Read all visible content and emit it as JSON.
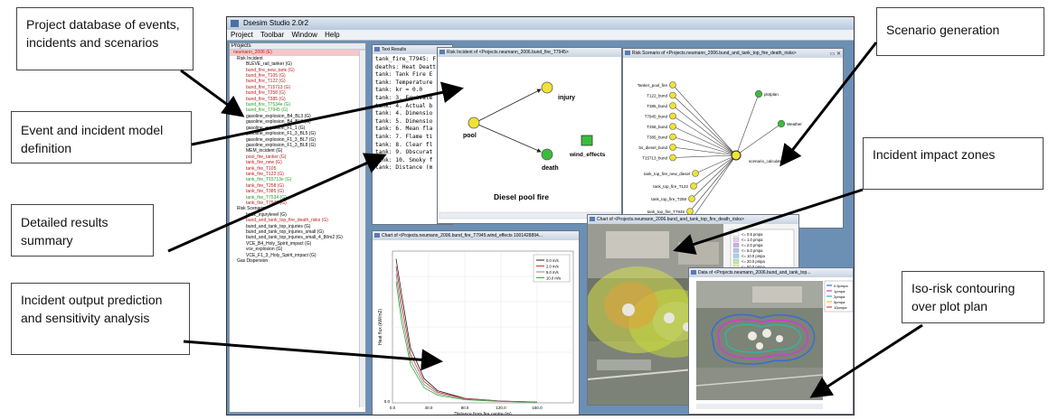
{
  "callouts": {
    "project_database": "Project database of events, incidents and scenarios",
    "event_incident": "Event and incident model definition",
    "detailed_results": "Detailed results summary",
    "incident_output": "Incident output prediction and sensitivity analysis",
    "scenario_generation": "Scenario generation",
    "impact_zones": "Incident impact zones",
    "iso_risk": "Iso-risk contouring over plot plan"
  },
  "app": {
    "title": "Dsesim Studio 2.0r2",
    "menu": [
      "Project",
      "Toolbar",
      "Window",
      "Help"
    ]
  },
  "tree": {
    "header": "Projects",
    "root": "neumann_2006 (E)",
    "risk_incident": "Risk Incident",
    "incidents": [
      {
        "label": "BLEVE_rail_tanker (G)",
        "color": "black"
      },
      {
        "label": "bund_fire_new_tank (G)",
        "color": "red"
      },
      {
        "label": "bund_fire_T105 (G)",
        "color": "red"
      },
      {
        "label": "bund_fire_T122 (G)",
        "color": "red"
      },
      {
        "label": "bund_fire_T15713 (G)",
        "color": "red"
      },
      {
        "label": "bund_fire_T258 (G)",
        "color": "red"
      },
      {
        "label": "bund_fire_T385 (G)",
        "color": "red"
      },
      {
        "label": "bund_fire_T7534e (G)",
        "color": "green"
      },
      {
        "label": "bund_fire_T7945 (G)",
        "color": "green"
      },
      {
        "label": "gasoline_explosion_B4_BL3 (G)",
        "color": "black"
      },
      {
        "label": "gasoline_explosion_B4_BL8 (G)",
        "color": "black"
      },
      {
        "label": "gasoline_explosion_F1_1 (G)",
        "color": "black"
      },
      {
        "label": "gasoline_explosion_F1_3_BL5 (G)",
        "color": "black"
      },
      {
        "label": "gasoline_explosion_F1_3_BL7 (G)",
        "color": "black"
      },
      {
        "label": "gasoline_explosion_F1_3_BL8 (G)",
        "color": "black"
      },
      {
        "label": "MEM_incident (G)",
        "color": "black"
      },
      {
        "label": "pool_fire_tanker (G)",
        "color": "red"
      },
      {
        "label": "tank_fire_new (G)",
        "color": "red"
      },
      {
        "label": "tank_fire_T105",
        "color": "red"
      },
      {
        "label": "tank_fire_T122 (G)",
        "color": "red"
      },
      {
        "label": "tank_fire_T15713e (G)",
        "color": "green"
      },
      {
        "label": "tank_fire_T258 (G)",
        "color": "red"
      },
      {
        "label": "tank_fire_T385 (G)",
        "color": "red"
      },
      {
        "label": "tank_fire_T7534 (G)",
        "color": "green"
      },
      {
        "label": "tank_fire_T7945 (G)",
        "color": "red"
      }
    ],
    "risk_scenario": "Risk Scenario",
    "scenarios": [
      {
        "label": "bob2_injurylevel (G)",
        "color": "black"
      },
      {
        "label": "bund_and_tank_top_fire_death_risks (G)",
        "color": "red"
      },
      {
        "label": "bund_and_tank_top_injuries (G)",
        "color": "black"
      },
      {
        "label": "bund_and_tank_top_injuries_small (G)",
        "color": "black"
      },
      {
        "label": "bund_and_tank_top_injuries_small_4_8t/m2 (G)",
        "color": "black"
      },
      {
        "label": "VCE_B4_Holy_Spirit_impact (G)",
        "color": "black"
      },
      {
        "label": "vce_explosion (G)",
        "color": "black"
      },
      {
        "label": "VCE_F1_3_Holy_Spirit_impact (G)",
        "color": "black"
      }
    ],
    "gas_dispersion": "Gas Dispersion"
  },
  "text_results": {
    "title": "Text Results",
    "lines": [
      "tank_fire_T7945: F",
      "deaths: Heat Deatt",
      "tank: Tank Fire E",
      "tank: Temperature",
      "tank: kr = 0.0",
      "tank: 3. Equivale",
      "tank: 4. Actual b",
      "tank: 4. Dimensio",
      "tank: 5. Dimensio",
      "tank: 6. Mean fla",
      "tank: 7. Flame ti",
      "tank: 8. Clear fl",
      "tank: 9. Obscurat",
      "tank: 10. Smoky f",
      "tank: Distance (m"
    ]
  },
  "risk_incident_window": {
    "title": "Risk Incident of <Projects.neumann_2006.bund_fire_T7945>",
    "nodes": {
      "pool": "pool",
      "injury": "injury",
      "death": "death",
      "wind": "wind_effects"
    },
    "caption": "Diesel pool fire",
    "side_label": "tank"
  },
  "risk_scenario_window": {
    "title": "Risk Scenario of <Projects.neumann_2006.bund_and_tank_top_fire_death_risks>",
    "left_nodes": [
      "Tanker_pool_fire",
      "T122_bund",
      "T385_bund",
      "T7945_bund",
      "T258_bund",
      "T385_bund",
      "bs_diesel_bund",
      "T15713_bund"
    ],
    "bottom_nodes": [
      "tank_top_fire_new_diesel",
      "tank_top_fire_T122",
      "tank_top_fire_T258",
      "tank_top_fire_T7945",
      "tank_top_fire_T385"
    ],
    "right_nodes": [
      "plotplan",
      "Weather"
    ],
    "hub_label": "scenario_calculator"
  },
  "chart_window": {
    "title": "Chart of <Projects.neumann_2006.bund_fire_T7945.wind_effects 1001428894...",
    "chart_data": {
      "type": "line",
      "xlabel": "Distance from fire centre (m)",
      "ylabel": "Heat flux (kW/m2)",
      "xlim": [
        0,
        200
      ],
      "x_ticks": [
        "0.0",
        "40.0",
        "80.0",
        "120.0",
        "160.0"
      ],
      "y_ticks": [
        "0.0"
      ],
      "series": [
        {
          "name": "0.0 m/s",
          "color": "#222222",
          "x": [
            4,
            10,
            20,
            35,
            50,
            80,
            120,
            160
          ],
          "y": [
            0.95,
            0.72,
            0.36,
            0.16,
            0.08,
            0.03,
            0.012,
            0.006
          ]
        },
        {
          "name": "2.0 m/s",
          "color": "#cc3333",
          "x": [
            4,
            10,
            20,
            35,
            50,
            80,
            120,
            160
          ],
          "y": [
            0.9,
            0.66,
            0.32,
            0.14,
            0.07,
            0.028,
            0.011,
            0.005
          ]
        },
        {
          "name": "5.0 m/s",
          "color": "#888888",
          "x": [
            4,
            10,
            20,
            35,
            50,
            80,
            120,
            160
          ],
          "y": [
            0.85,
            0.6,
            0.28,
            0.12,
            0.06,
            0.025,
            0.01,
            0.005
          ]
        },
        {
          "name": "10.0 m/s",
          "color": "#33aa33",
          "x": [
            4,
            10,
            20,
            35,
            50,
            80,
            120,
            160
          ],
          "y": [
            0.8,
            0.54,
            0.25,
            0.1,
            0.05,
            0.02,
            0.009,
            0.004
          ]
        }
      ]
    }
  },
  "impact_window": {
    "title": "Chart of <Projects.neumann_2006.bund_and_tank_top_fire_death_risks>",
    "legend": [
      "<= 0.5 pmpa",
      "<= 1.0 pmpa",
      "<= 2.0 pmpa",
      "<= 5.0 pmpa",
      "<= 10.0 pmpa",
      "<= 20.0 pmpa",
      "<= 50.0 pmpa"
    ]
  },
  "iso_window": {
    "title": "Data of <Projects.neumann_2006.bund_and_tank_top...",
    "legend": [
      "0.5pmpa",
      "1pmpa",
      "2pmpa",
      "5pmpa",
      "10pmpa"
    ]
  },
  "colors": {
    "accent_red": "#b81e1e",
    "accent_green": "#2e9b2e",
    "desktop": "#6c8fb4"
  }
}
